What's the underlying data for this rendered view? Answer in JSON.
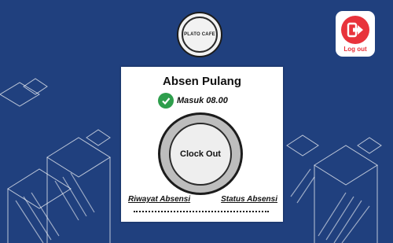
{
  "logo": {
    "text": "PLATO CAFE"
  },
  "logout": {
    "label": "Log out"
  },
  "card": {
    "title": "Absen Pulang",
    "status_text": "Masuk 08.00",
    "clock_button": "Clock Out",
    "link_history": "Riwayat Absensi",
    "link_status": "Status Absensi"
  },
  "colors": {
    "background": "#20407e",
    "logout_accent": "#e8333b",
    "check": "#2e9e4c"
  },
  "icons": {
    "logout": "logout-arrow-icon",
    "status": "check-circle-icon"
  }
}
